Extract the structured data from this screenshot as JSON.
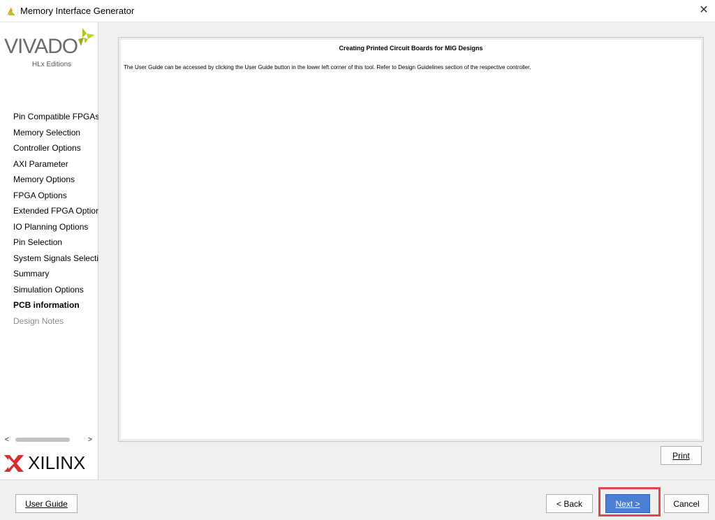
{
  "window": {
    "title": "Memory Interface Generator",
    "close_glyph": "✕",
    "icon": "vivado-leaf-icon"
  },
  "branding": {
    "vivado_text": "VIVADO",
    "vivado_sub": "HLx Editions",
    "xilinx_text": "XILINX",
    "accent_color": "#b5c21f",
    "xilinx_red": "#d32f2f"
  },
  "sidebar": {
    "items": [
      {
        "label": "Pin Compatible FPGAs",
        "state": "normal"
      },
      {
        "label": "Memory Selection",
        "state": "normal"
      },
      {
        "label": "Controller Options",
        "state": "normal"
      },
      {
        "label": "AXI Parameter",
        "state": "normal"
      },
      {
        "label": "Memory Options",
        "state": "normal"
      },
      {
        "label": "FPGA Options",
        "state": "normal"
      },
      {
        "label": "Extended FPGA Options",
        "state": "normal"
      },
      {
        "label": "IO Planning Options",
        "state": "normal"
      },
      {
        "label": "Pin Selection",
        "state": "normal"
      },
      {
        "label": "System Signals Selection",
        "state": "normal"
      },
      {
        "label": "Summary",
        "state": "normal"
      },
      {
        "label": "Simulation Options",
        "state": "normal"
      },
      {
        "label": "PCB information",
        "state": "active"
      },
      {
        "label": "Design Notes",
        "state": "disabled"
      }
    ],
    "scroll_left": "<",
    "scroll_right": ">"
  },
  "document": {
    "heading": "Creating Printed Circuit Boards for MIG Designs",
    "body": "The User Guide can be accessed by clicking the User Guide button in the lower left corner of this tool. Refer to Design Guidelines section of the respective controller."
  },
  "buttons": {
    "print": "Print",
    "user_guide": "User Guide",
    "back": "< Back",
    "next": "Next >",
    "cancel": "Cancel"
  },
  "highlight_color": "#e0474c",
  "primary_button_color": "#4a7fd4"
}
